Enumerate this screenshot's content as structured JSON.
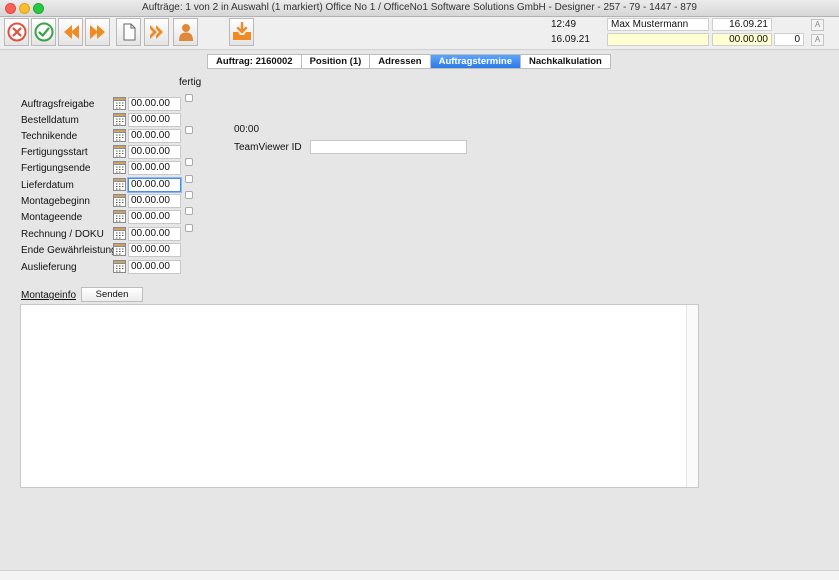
{
  "window": {
    "title": "Aufträge: 1 von 2 in Auswahl  (1 markiert) Office No 1 /  OfficeNo1 Software Solutions GmbH - Designer - 257 - 79 - 1447 - 879"
  },
  "toolbar": {
    "buttons": [
      "cancel-icon",
      "confirm-icon",
      "previous-icon",
      "next-icon",
      "new-document-icon",
      "skip-forward-icon",
      "person-icon",
      "inbox-download-icon"
    ],
    "colors": {
      "orange": "#f08a24",
      "green": "#3aa34a",
      "red": "#e0513e"
    }
  },
  "info": {
    "time": "12:49",
    "user": "Max Mustermann",
    "date_right": "16.09.21",
    "date_left": "16.09.21",
    "yellow_field": "",
    "amount": "00.00.00",
    "count": "0",
    "font_up_label": "A",
    "font_down_label": "A"
  },
  "tabs": [
    {
      "label": "Auftrag: 2160002",
      "active": false
    },
    {
      "label": "Position (1)",
      "active": false
    },
    {
      "label": "Adressen",
      "active": false
    },
    {
      "label": "Auftragstermine",
      "active": true
    },
    {
      "label": "Nachkalkulation",
      "active": false
    }
  ],
  "form": {
    "fertig_header": "fertig",
    "rows": [
      {
        "label": "Auftragsfreigabe",
        "value": "00.00.00"
      },
      {
        "label": "Bestelldatum",
        "value": "00.00.00"
      },
      {
        "label": "Technikende",
        "value": "00.00.00"
      },
      {
        "label": "Fertigungsstart",
        "value": "00.00.00"
      },
      {
        "label": "Fertigungsende",
        "value": "00.00.00"
      },
      {
        "label": "Lieferdatum",
        "value": "00.00.00"
      },
      {
        "label": "Montagebeginn",
        "value": "00.00.00"
      },
      {
        "label": "Montageende",
        "value": "00.00.00"
      },
      {
        "label": "Rechnung / DOKU",
        "value": "00.00.00"
      },
      {
        "label": "Ende Gewährleistung",
        "value": "00.00.00"
      },
      {
        "label": "Auslieferung",
        "value": "00.00.00"
      }
    ],
    "time_value": "00:00",
    "teamviewer_label": "TeamViewer ID",
    "teamviewer_value": ""
  },
  "montage": {
    "label": "Montageinfo",
    "send_label": "Senden",
    "text": ""
  }
}
